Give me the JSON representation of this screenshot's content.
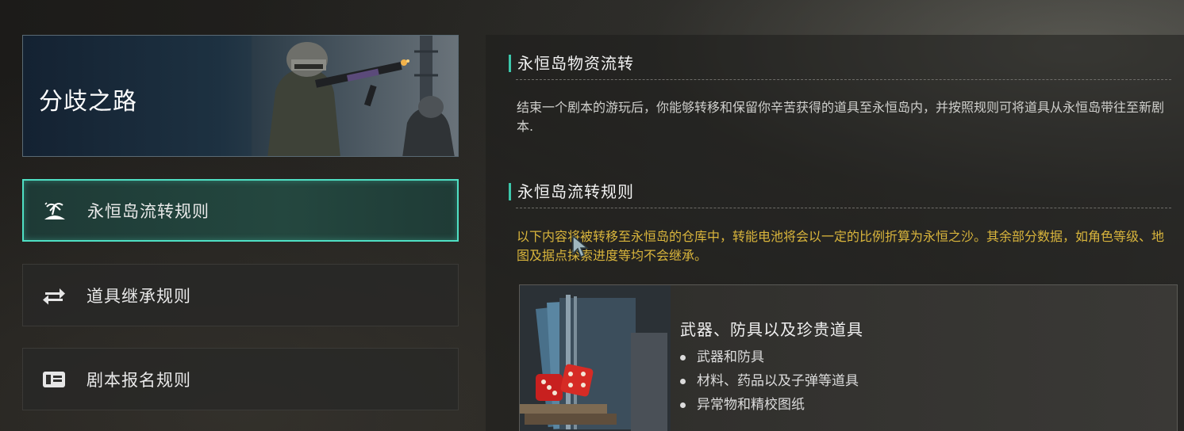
{
  "banner": {
    "title": "分歧之路"
  },
  "menu": [
    {
      "label": "永恒岛流转规则",
      "icon": "island-icon",
      "active": true
    },
    {
      "label": "道具继承规则",
      "icon": "swap-arrows-icon",
      "active": false
    },
    {
      "label": "剧本报名规则",
      "icon": "id-card-icon",
      "active": false
    }
  ],
  "sections": [
    {
      "title": "永恒岛物资流转",
      "text": "结束一个剧本的游玩后，你能够转移和保留你辛苦获得的道具至永恒岛内，并按照规则可将道具从永恒岛带往至新剧本."
    },
    {
      "title": "永恒岛流转规则",
      "text": "以下内容将被转移至永恒岛的仓库中，转能电池将会以一定的比例折算为永恒之沙。其余部分数据，如角色等级、地图及据点探索进度等均不会继承。"
    }
  ],
  "card": {
    "title": "武器、防具以及珍贵道具",
    "items": [
      "武器和防具",
      "材料、药品以及子弹等道具",
      "异常物和精校图纸"
    ]
  },
  "colors": {
    "accent": "#4fe0c4",
    "section_bar": "#3cc7ab",
    "highlight_text": "#d9b53c"
  }
}
